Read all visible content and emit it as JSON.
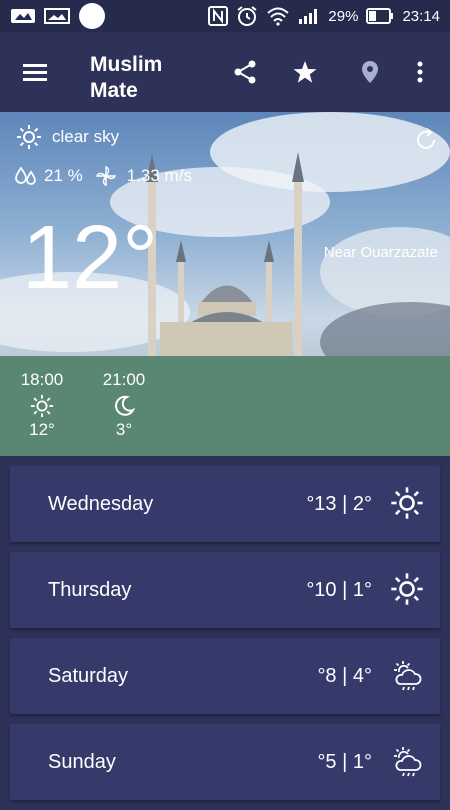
{
  "status_bar": {
    "battery": "29%",
    "time": "23:14"
  },
  "app_bar": {
    "title_line1": "Muslim",
    "title_line2": "Mate",
    "icons": [
      "menu-icon",
      "share-icon",
      "star-icon",
      "location-pin-icon",
      "more-vert-icon"
    ]
  },
  "current": {
    "condition": "clear sky",
    "humidity": "21 %",
    "wind": "1.33 m/s",
    "temperature": "12°",
    "location": "Near Ouarzazate"
  },
  "hourly": [
    {
      "time": "18:00",
      "icon": "sun-icon",
      "temp": "12°"
    },
    {
      "time": "21:00",
      "icon": "moon-icon",
      "temp": "3°"
    }
  ],
  "forecast": [
    {
      "day": "Wednesday",
      "range": "°13 | 2°",
      "icon": "sun-icon"
    },
    {
      "day": "Thursday",
      "range": "°10 | 1°",
      "icon": "sun-icon"
    },
    {
      "day": "Saturday",
      "range": "°8 | 4°",
      "icon": "sun-rain-cloud-icon"
    },
    {
      "day": "Sunday",
      "range": "°5 | 1°",
      "icon": "sun-rain-cloud-icon"
    }
  ],
  "colors": {
    "background": "#2e3259",
    "card": "#353a6b",
    "status_bar": "#262a4c",
    "hero_overlay": "#46826e"
  }
}
